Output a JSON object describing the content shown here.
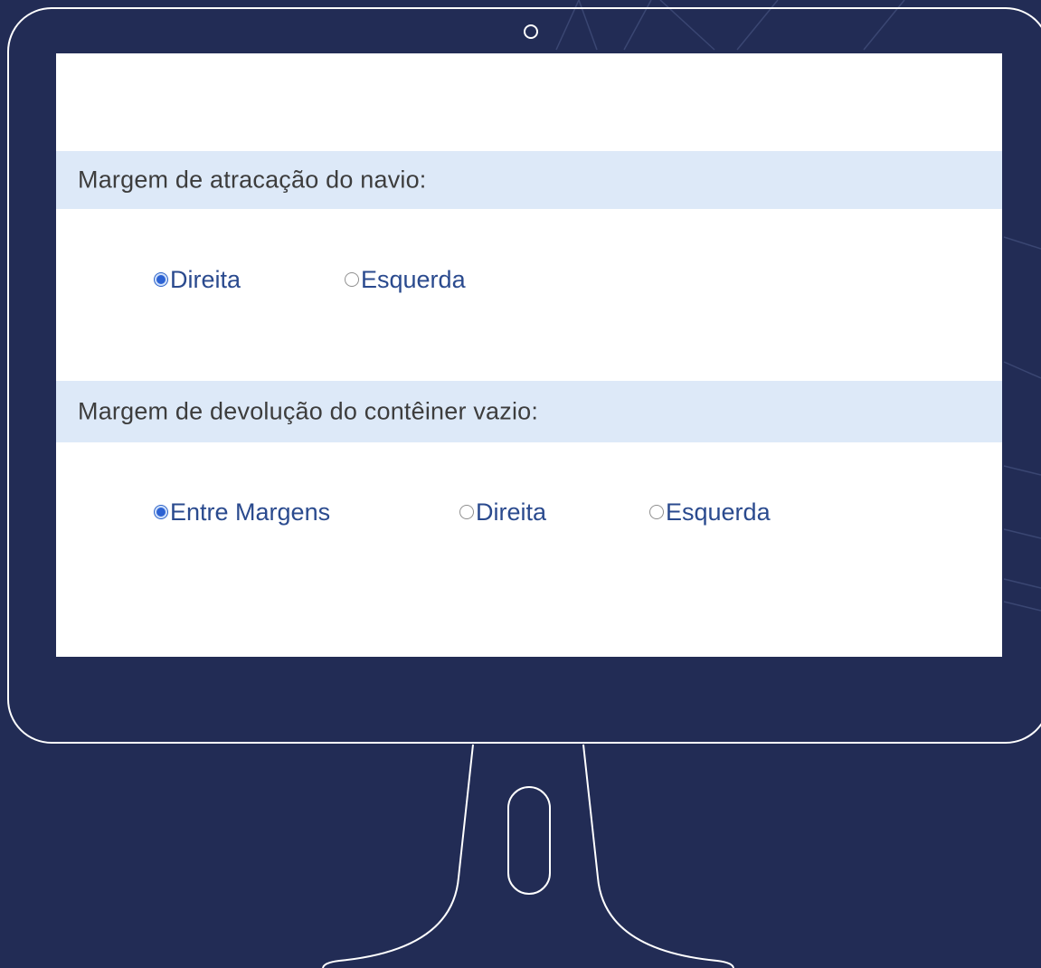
{
  "form": {
    "section1": {
      "title": "Margem de atracação do navio:",
      "options": [
        {
          "label": "Direita",
          "checked": true
        },
        {
          "label": "Esquerda",
          "checked": false
        }
      ]
    },
    "section2": {
      "title": "Margem de devolução do contêiner vazio:",
      "options": [
        {
          "label": "Entre Margens",
          "checked": true
        },
        {
          "label": "Direita",
          "checked": false
        },
        {
          "label": "Esquerda",
          "checked": false
        }
      ]
    }
  },
  "colors": {
    "background": "#222c55",
    "monitor_outline": "#ffffff",
    "section_header": "#dde9f8",
    "radio_label": "#2a4a8e",
    "radio_selected": "#2c62d3"
  }
}
